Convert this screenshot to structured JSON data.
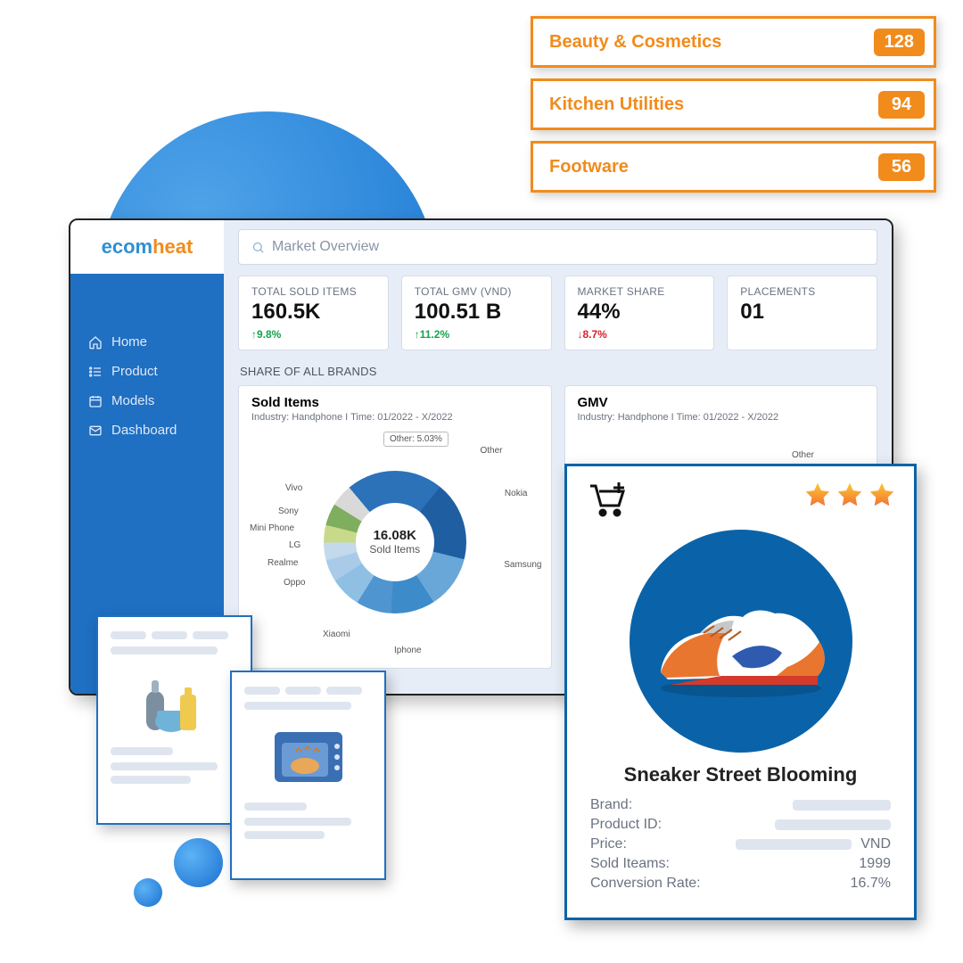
{
  "brand": {
    "a": "ecom",
    "b": "heat"
  },
  "search": {
    "placeholder": "Market Overview"
  },
  "nav": {
    "items": [
      {
        "label": "Home"
      },
      {
        "label": "Product"
      },
      {
        "label": "Models"
      },
      {
        "label": "Dashboard"
      }
    ]
  },
  "kpi": [
    {
      "label": "TOTAL SOLD ITEMS",
      "value": "160.5K",
      "delta": "9.8%",
      "dir": "up"
    },
    {
      "label": "TOTAL GMV (VND)",
      "value": "100.51 B",
      "delta": "11.2%",
      "dir": "up"
    },
    {
      "label": "MARKET SHARE",
      "value": "44%",
      "delta": "8.7%",
      "dir": "down"
    },
    {
      "label": "PLACEMENTS",
      "value": "01",
      "delta": "",
      "dir": ""
    }
  ],
  "section_title": "SHARE OF ALL BRANDS",
  "panels": {
    "left": {
      "title": "Sold Items",
      "sub": "Industry: Handphone  I  Time: 01/2022 - X/2022",
      "center_value": "16.08K",
      "center_label": "Sold Items",
      "tooltip": "Other: 5.03%"
    },
    "right": {
      "title": "GMV",
      "sub": "Industry: Handphone  I  Time: 01/2022 - X/2022",
      "other_label": "Other"
    }
  },
  "chart_data": {
    "type": "pie",
    "title": "Sold Items — Share of All Brands",
    "center_total": "16.08K",
    "series": [
      {
        "name": "Samsung",
        "value": 22,
        "color": "#2b72b9"
      },
      {
        "name": "Iphone",
        "value": 18,
        "color": "#1f5ea1"
      },
      {
        "name": "Xiaomi",
        "value": 12,
        "color": "#6aa7d9"
      },
      {
        "name": "Oppo",
        "value": 10,
        "color": "#3d8bc9"
      },
      {
        "name": "Nokia",
        "value": 8,
        "color": "#4f95cf"
      },
      {
        "name": "Realme",
        "value": 7,
        "color": "#8fbfe3"
      },
      {
        "name": "LG",
        "value": 5,
        "color": "#a9cbe9"
      },
      {
        "name": "Mini Phone",
        "value": 4,
        "color": "#c4d9eb"
      },
      {
        "name": "Sony",
        "value": 4,
        "color": "#c9d98a"
      },
      {
        "name": "Vivo",
        "value": 5,
        "color": "#7fae5f"
      },
      {
        "name": "Other",
        "value": 5.03,
        "color": "#d9d9d9"
      }
    ]
  },
  "categories": [
    {
      "name": "Beauty & Cosmetics",
      "count": "128"
    },
    {
      "name": "Kitchen Utilities",
      "count": "94"
    },
    {
      "name": "Footware",
      "count": "56"
    }
  ],
  "product": {
    "title": "Sneaker Street Blooming",
    "rows": {
      "brand_label": "Brand:",
      "pid_label": "Product ID:",
      "price_label": "Price:",
      "price_unit": "VND",
      "sold_label": "Sold Iteams:",
      "sold_value": "1999",
      "cr_label": "Conversion Rate:",
      "cr_value": "16.7%"
    }
  }
}
